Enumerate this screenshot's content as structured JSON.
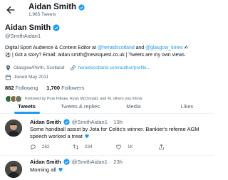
{
  "header": {
    "name": "Aidan Smith",
    "tweet_count": "1,965 Tweets"
  },
  "profile": {
    "name": "Aidan Smith",
    "handle": "@SmithAidan1",
    "bio": {
      "line1_a": "Digital Sport Audience & Content Editor at ",
      "mention1": "@heraldscotland",
      "line1_b": " and ",
      "mention2": "@glasgow_times",
      "line2": "| Got a story? Email: aidan.smith@newsquest.co.uk | Tweets are my own views."
    },
    "location": "Glasgow/Perth, Scotland",
    "website": "heraldscotland.com/author/profile...",
    "joined": "Joined May 2011",
    "following_count": "882",
    "following_label": "Following",
    "followers_count": "1,700",
    "followers_label": "Followers",
    "followed_by": "Followed by Pure Fitbaw, Ryan McDonald, and 41 others you follow"
  },
  "tabs": [
    {
      "label": "Tweets",
      "active": true
    },
    {
      "label": "Tweets & replies",
      "active": false
    },
    {
      "label": "Media",
      "active": false
    },
    {
      "label": "Likes",
      "active": false
    }
  ],
  "tweets": [
    {
      "name": "Aidan Smith",
      "handle": "@SmithAidan1",
      "dot": "·",
      "time": "13h",
      "text": "Some handball assist by Jota for Celtic's winner. Bankier's referee AGM speech worked a treat",
      "reply_count": "262",
      "retweet_count": "234",
      "like_count": "1K"
    },
    {
      "name": "Aidan Smith",
      "handle": "@SmithAidan1",
      "dot": "·",
      "time": "23h",
      "text": "Morning all"
    }
  ],
  "colors": {
    "accent": "#1d9bf0",
    "text": "#0f1419",
    "secondary": "#536471",
    "heart": "#1d9bf0"
  },
  "icons": {
    "back": "arrow-left-icon",
    "verified": "verified-badge-icon",
    "location": "location-pin-icon",
    "link": "link-icon",
    "calendar": "calendar-icon",
    "reply": "reply-icon",
    "retweet": "retweet-icon",
    "like": "heart-icon",
    "share": "share-icon"
  }
}
